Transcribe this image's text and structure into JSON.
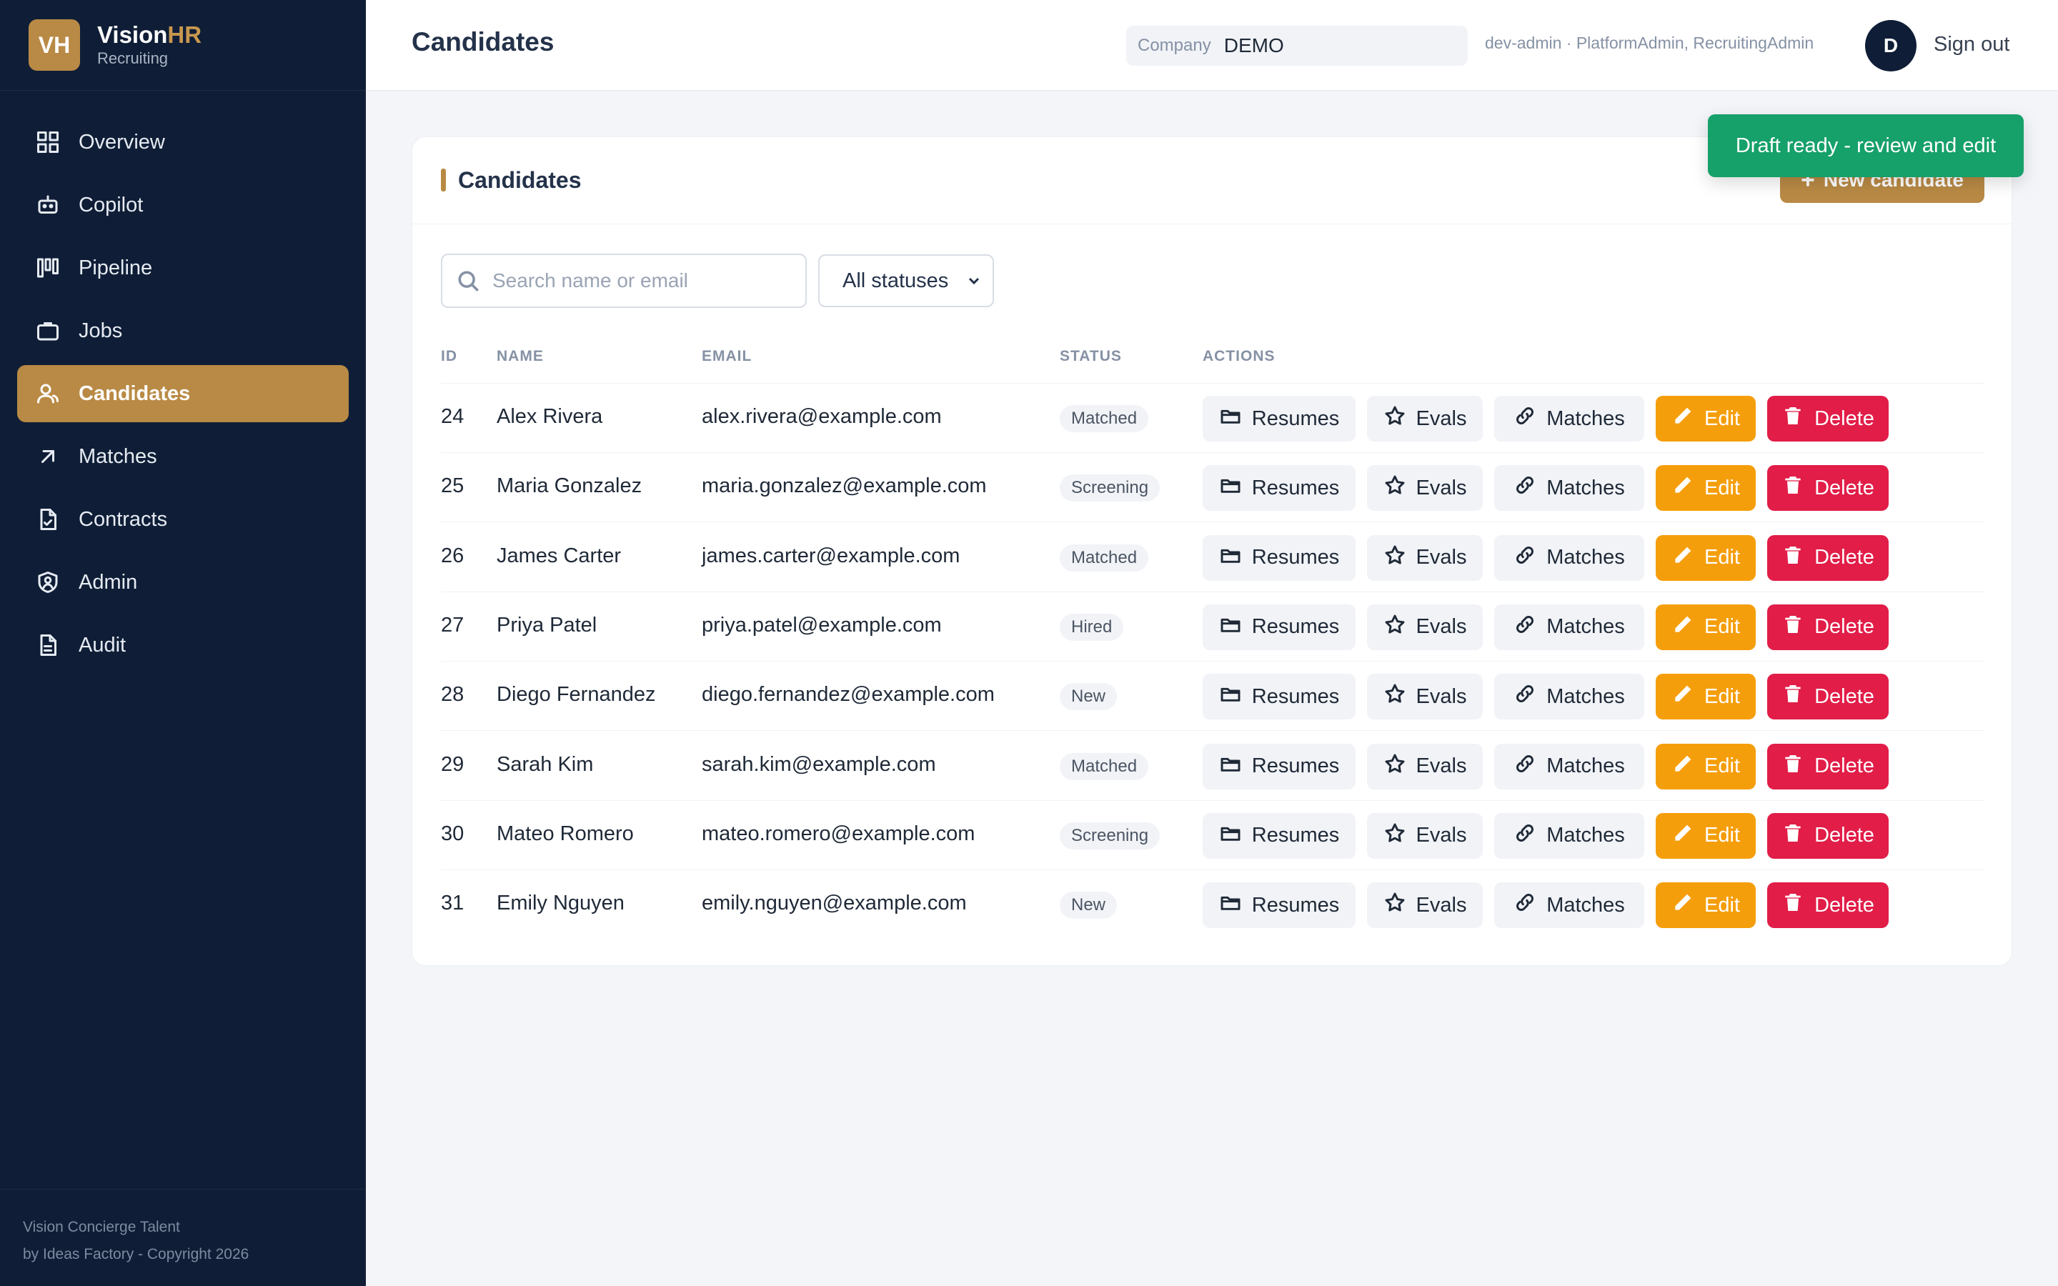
{
  "brand": {
    "logo": "VH",
    "name_main": "Vision",
    "name_accent": "HR",
    "subtitle": "Recruiting",
    "accent_color": "#b98a45"
  },
  "sidebar": {
    "items": [
      {
        "label": "Overview",
        "icon": "grid-icon"
      },
      {
        "label": "Copilot",
        "icon": "bot-icon"
      },
      {
        "label": "Pipeline",
        "icon": "kanban-icon"
      },
      {
        "label": "Jobs",
        "icon": "briefcase-icon"
      },
      {
        "label": "Candidates",
        "icon": "users-icon",
        "active": true
      },
      {
        "label": "Matches",
        "icon": "arrow-up-right-icon"
      },
      {
        "label": "Contracts",
        "icon": "file-check-icon"
      },
      {
        "label": "Admin",
        "icon": "shield-user-icon"
      },
      {
        "label": "Audit",
        "icon": "file-text-icon"
      }
    ],
    "footer_line1": "Vision Concierge Talent",
    "footer_line2": "by Ideas Factory - Copyright 2026"
  },
  "header": {
    "title": "Candidates",
    "company_label": "Company",
    "company_value": "DEMO",
    "user_info": "dev-admin · PlatformAdmin, RecruitingAdmin",
    "avatar_initial": "D",
    "signout_label": "Sign out"
  },
  "card": {
    "title": "Candidates",
    "new_button_label": "New candidate",
    "search_placeholder": "Search name or email",
    "status_filter": "All statuses"
  },
  "table": {
    "columns": [
      "ID",
      "NAME",
      "EMAIL",
      "STATUS",
      "ACTIONS"
    ],
    "actions": {
      "resumes": "Resumes",
      "evals": "Evals",
      "matches": "Matches",
      "edit": "Edit",
      "delete": "Delete"
    },
    "rows": [
      {
        "id": "24",
        "name": "Alex Rivera",
        "email": "alex.rivera@example.com",
        "status": "Matched"
      },
      {
        "id": "25",
        "name": "Maria Gonzalez",
        "email": "maria.gonzalez@example.com",
        "status": "Screening"
      },
      {
        "id": "26",
        "name": "James Carter",
        "email": "james.carter@example.com",
        "status": "Matched"
      },
      {
        "id": "27",
        "name": "Priya Patel",
        "email": "priya.patel@example.com",
        "status": "Hired"
      },
      {
        "id": "28",
        "name": "Diego Fernandez",
        "email": "diego.fernandez@example.com",
        "status": "New"
      },
      {
        "id": "29",
        "name": "Sarah Kim",
        "email": "sarah.kim@example.com",
        "status": "Matched"
      },
      {
        "id": "30",
        "name": "Mateo Romero",
        "email": "mateo.romero@example.com",
        "status": "Screening"
      },
      {
        "id": "31",
        "name": "Emily Nguyen",
        "email": "emily.nguyen@example.com",
        "status": "New"
      }
    ]
  },
  "toast": {
    "message": "Draft ready - review and edit",
    "color": "#16a06a"
  }
}
